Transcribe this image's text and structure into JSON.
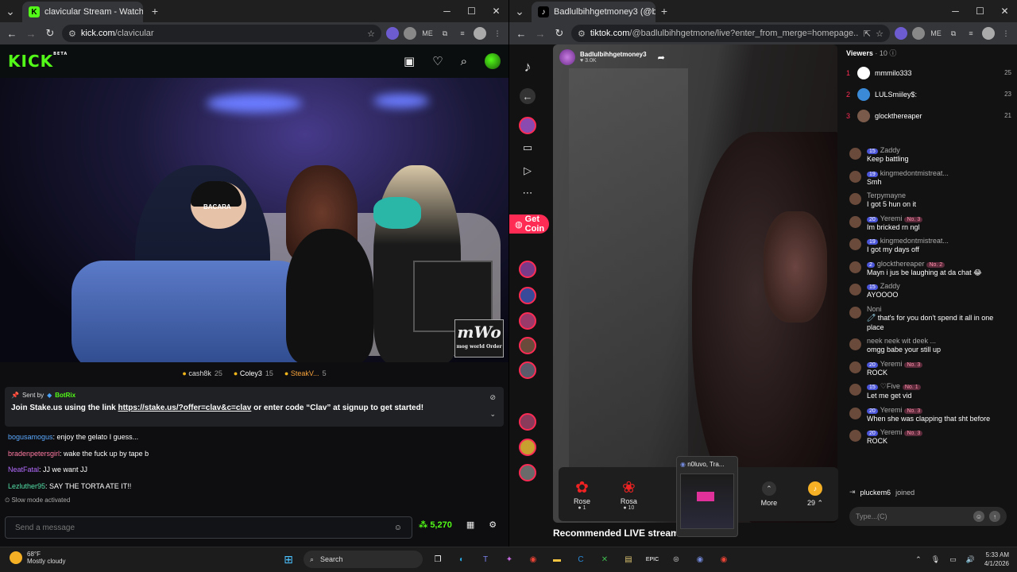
{
  "left_window": {
    "tab_title": "clavicular Stream - Watch Live o",
    "url_host": "kick.com",
    "url_path": "/clavicular",
    "header": {
      "logo": "KICK",
      "logo_badge": "BETA"
    },
    "leaderboard": [
      {
        "name": "cash8k",
        "value": "25"
      },
      {
        "name": "Coley3",
        "value": "15"
      },
      {
        "name": "SteakV...",
        "value": "5"
      }
    ],
    "pinned": {
      "sent_by_label": "Sent by",
      "sent_by": "BotRix",
      "message_prefix": "Join Stake.us using the link",
      "link": "https://stake.us/?offer=clav&c=clav",
      "message_suffix": "or enter code “Clav” at signup to get started!"
    },
    "chat": [
      {
        "user": "bogusamogus",
        "color": "#5aa9ff",
        "text": ": enjoy the gelato I guess..."
      },
      {
        "user": "bradenpetersgirl",
        "color": "#ff7aa2",
        "text": ": wake the fuck up by tape b"
      },
      {
        "user": "NeatFatal",
        "color": "#b46cff",
        "text": ": JJ we want JJ"
      },
      {
        "user": "Lezluther95",
        "color": "#53e0a8",
        "text": ": SAY THE TORTA ATE IT!!"
      }
    ],
    "slow_mode": "Slow mode activated",
    "input_placeholder": "Send a message",
    "points": "5,270",
    "overlay_logo": "mWo",
    "overlay_caption": "mog world Order",
    "stream_scene_text": "BACARA"
  },
  "right_window": {
    "tab_title": "Badlulbihhgetmoney3 (@ba",
    "url_host": "tiktok.com",
    "url_path": "/@badlulbihhgetmone/live?enter_from_merge=homepage...",
    "get_coins": "Get Coin",
    "host_name": "Badlulbihhgetmoney3",
    "host_likes": "3.0K",
    "gifts": [
      {
        "name": "Rose",
        "price": "1"
      },
      {
        "name": "Rosa",
        "price": "10"
      }
    ],
    "gift_more": "More",
    "gift_count": "29",
    "recommended": "Recommended LIVE stream",
    "popup_title": "n0luvo, Tra...",
    "viewers_label": "Viewers",
    "viewers_count": "· 10",
    "top_viewers": [
      {
        "rank": "1",
        "name": "mmmilo333",
        "score": "25"
      },
      {
        "rank": "2",
        "name": "LULSmiiley$:",
        "score": "23"
      },
      {
        "rank": "3",
        "name": "glockthereaper",
        "score": "21"
      }
    ],
    "comments": [
      {
        "level": "15",
        "user": "Zaddy",
        "fan": "",
        "text": "Keep battling"
      },
      {
        "level": "19",
        "user": "kingmedontmistreat...",
        "fan": "",
        "text": "Smh"
      },
      {
        "level": "",
        "user": "Terpymayne",
        "fan": "",
        "text": "I got 5 hun on it"
      },
      {
        "level": "20",
        "user": "Yeremi",
        "fan": "No. 3",
        "text": "Im bricked rn ngl"
      },
      {
        "level": "19",
        "user": "kingmedontmistreat...",
        "fan": "",
        "text": "I got my days off"
      },
      {
        "level": "2",
        "user": "glockthereaper",
        "fan": "No. 2",
        "text": "Mayn i jus be laughing at da chat 😂"
      },
      {
        "level": "15",
        "user": "Zaddy",
        "fan": "",
        "text": "AYOOOO"
      },
      {
        "level": "",
        "user": "Noni",
        "fan": "",
        "text": "🧷 that's for you don't spend it all in one place"
      },
      {
        "level": "",
        "user": "neek neek wit deek ...",
        "fan": "",
        "text": "omgg babe your still up"
      },
      {
        "level": "20",
        "user": "Yeremi",
        "fan": "No. 3",
        "text": "ROCK"
      },
      {
        "level": "15",
        "user": "♡Five",
        "fan": "No. 1",
        "text": "Let me get vid"
      },
      {
        "level": "20",
        "user": "Yeremi",
        "fan": "No. 3",
        "text": "When she was clapping that sht before"
      },
      {
        "level": "20",
        "user": "Yeremi",
        "fan": "No. 3",
        "text": "ROCK"
      }
    ],
    "joined_user": "pluckem6",
    "joined_text": "joined",
    "input_placeholder": "Type...(C)"
  },
  "taskbar": {
    "temp": "68°F",
    "weather": "Mostly cloudy",
    "search_label": "Search",
    "time": "5:33 AM",
    "date": "4/1/2026"
  },
  "colors": {
    "kick_green": "#53fc18",
    "tiktok_pink": "#fe2c55"
  }
}
